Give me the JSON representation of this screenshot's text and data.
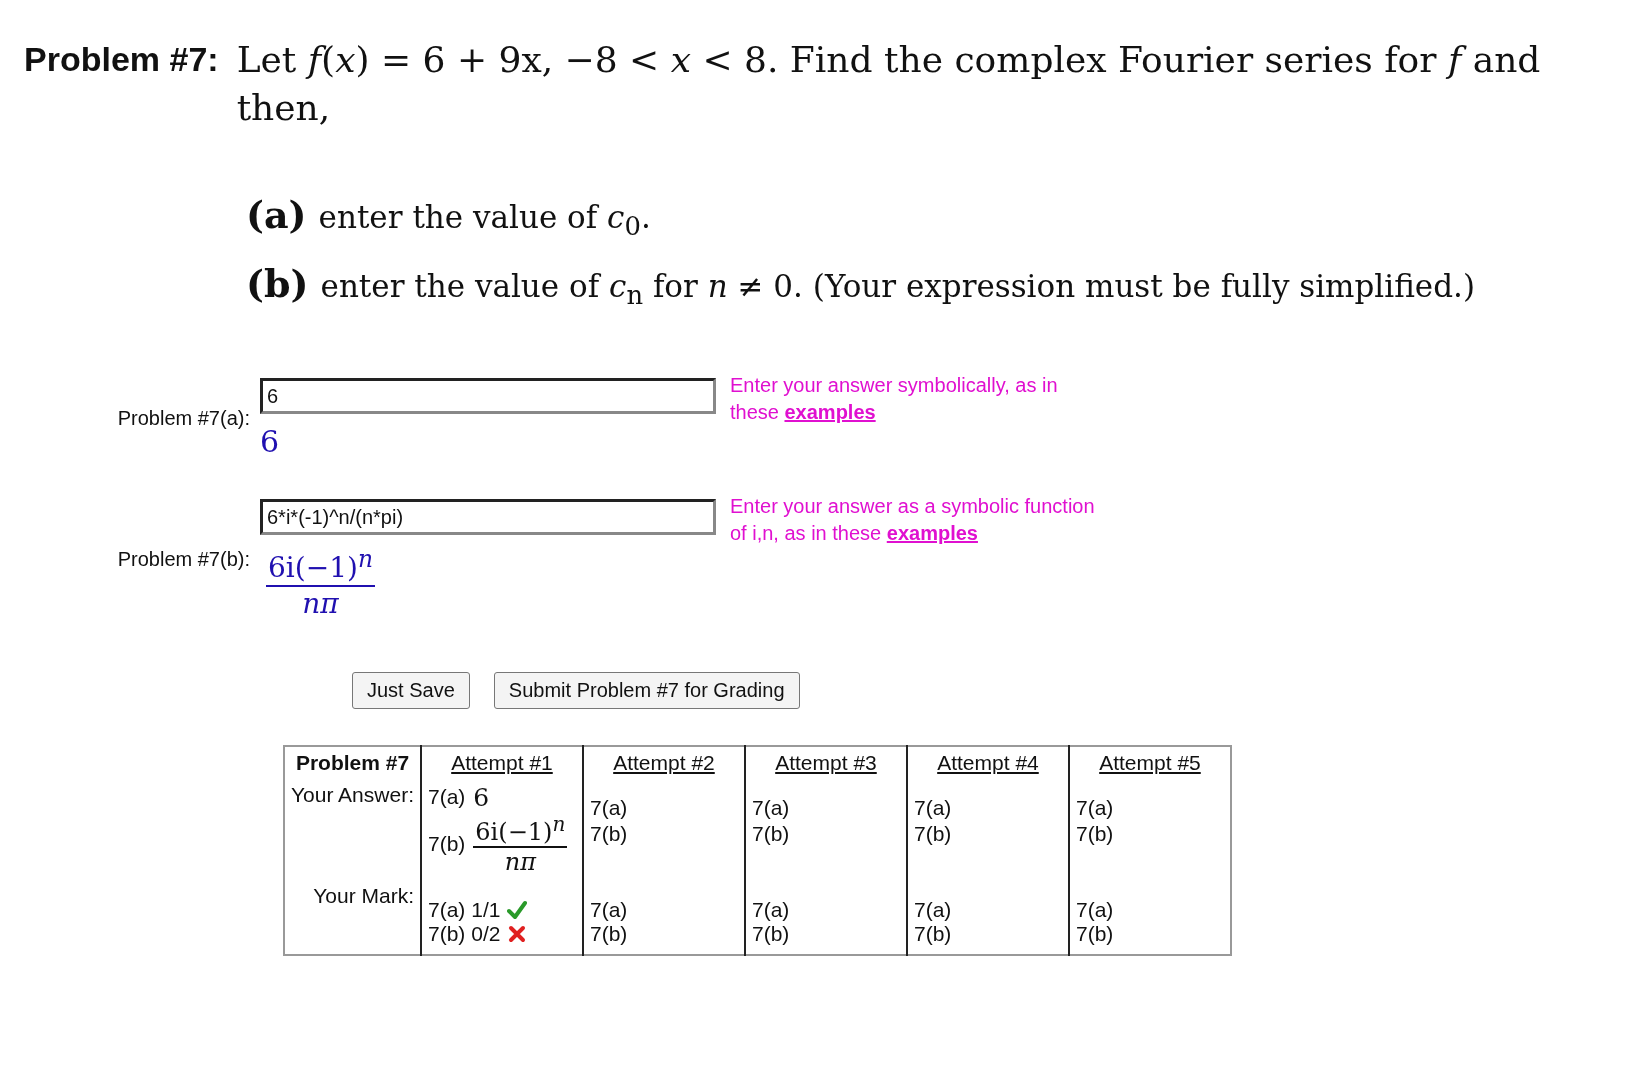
{
  "problem": {
    "heading": "Problem #7:",
    "statement": "Let *f*(*x*) = 6 + 9x, −8 < *x* < 8. Find the complex Fourier series for *f* and then,",
    "parts": [
      {
        "label": "(a)",
        "text": "enter the value of *c*$_{0}$."
      },
      {
        "label": "(b)",
        "text": "enter the value of *c*$_{n}$ for *n* ≠ 0. (Your expression must be fully simplified.)"
      }
    ]
  },
  "answers": [
    {
      "label": "Problem #7(a):",
      "value": "6",
      "kind": "plain",
      "rendered": "6",
      "hint": "Enter your answer symbolically, as in these",
      "link": "examples"
    },
    {
      "label": "Problem #7(b):",
      "value": "6*i*(-1)^n/(n*pi)",
      "kind": "fraction",
      "numerator": "6i(−1)$^{n}$",
      "denominator": "nπ",
      "hint": "Enter your answer as a symbolic function of i,n, as in these",
      "link": "examples"
    }
  ],
  "buttons": [
    "Just Save",
    "Submit Problem #7 for Grading"
  ],
  "table": {
    "corner": "Problem #7",
    "answer_row_label": "Your Answer:",
    "mark_row_label": "Your Mark:",
    "attempts": [
      {
        "title": "Attempt #1",
        "answers": [
          {
            "label": "7(a)",
            "kind": "plain",
            "value": "6"
          },
          {
            "label": "7(b)",
            "kind": "fraction",
            "numerator": "6i(−1)$^{n}$",
            "denominator": "nπ"
          }
        ],
        "marks": [
          {
            "label": "7(a)",
            "score": "1/1",
            "correct": true
          },
          {
            "label": "7(b)",
            "score": "0/2",
            "correct": false
          }
        ]
      },
      {
        "title": "Attempt #2",
        "answers": [
          {
            "label": "7(a)",
            "kind": "empty"
          },
          {
            "label": "7(b)",
            "kind": "empty"
          }
        ],
        "marks": [
          {
            "label": "7(a)"
          },
          {
            "label": "7(b)"
          }
        ]
      },
      {
        "title": "Attempt #3",
        "answers": [
          {
            "label": "7(a)",
            "kind": "empty"
          },
          {
            "label": "7(b)",
            "kind": "empty"
          }
        ],
        "marks": [
          {
            "label": "7(a)"
          },
          {
            "label": "7(b)"
          }
        ]
      },
      {
        "title": "Attempt #4",
        "answers": [
          {
            "label": "7(a)",
            "kind": "empty"
          },
          {
            "label": "7(b)",
            "kind": "empty"
          }
        ],
        "marks": [
          {
            "label": "7(a)"
          },
          {
            "label": "7(b)"
          }
        ]
      },
      {
        "title": "Attempt #5",
        "answers": [
          {
            "label": "7(a)",
            "kind": "empty"
          },
          {
            "label": "7(b)",
            "kind": "empty"
          }
        ],
        "marks": [
          {
            "label": "7(a)"
          },
          {
            "label": "7(b)"
          }
        ]
      }
    ]
  }
}
